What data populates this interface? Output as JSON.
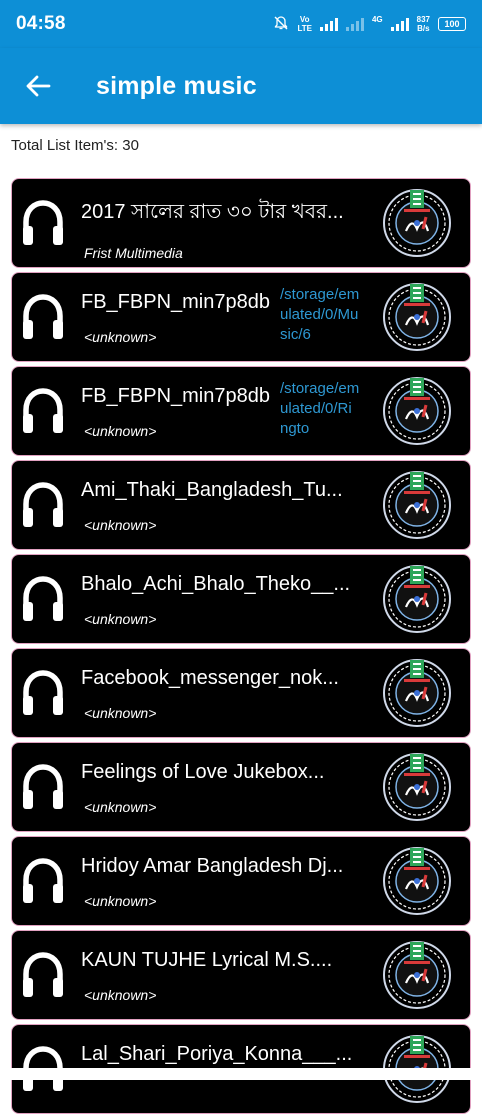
{
  "status": {
    "time": "04:58",
    "net_top": "Vo",
    "net_bottom": "LTE",
    "net4g": "4G",
    "speed_top": "837",
    "speed_bottom": "B/s",
    "battery": "100"
  },
  "appbar": {
    "title": "simple music"
  },
  "list": {
    "count_label": "Total List Item's: 30",
    "items": [
      {
        "name": "2017 সালের রাত ৩০ টার খবর...",
        "artist": "Frist Multimedia",
        "path": ""
      },
      {
        "name": "FB_FBPN_min7p8db",
        "artist": "<unknown>",
        "path": "/storage/emulated/0/Music/6"
      },
      {
        "name": "FB_FBPN_min7p8db",
        "artist": "<unknown>",
        "path": "/storage/emulated/0/Ringto"
      },
      {
        "name": "Ami_Thaki_Bangladesh_Tu...",
        "artist": "<unknown>",
        "path": ""
      },
      {
        "name": "Bhalo_Achi_Bhalo_Theko__...",
        "artist": "<unknown>",
        "path": ""
      },
      {
        "name": "Facebook_messenger_nok...",
        "artist": "<unknown>",
        "path": ""
      },
      {
        "name": "Feelings of Love Jukebox...",
        "artist": "<unknown>",
        "path": ""
      },
      {
        "name": "Hridoy Amar Bangladesh Dj...",
        "artist": "<unknown>",
        "path": ""
      },
      {
        "name": "KAUN TUJHE  Lyrical  M.S....",
        "artist": "<unknown>",
        "path": ""
      },
      {
        "name": "Lal_Shari_Poriya_Konna___...",
        "artist": "",
        "path": ""
      }
    ]
  },
  "colors": {
    "accent": "#0d8fd6",
    "row_bg": "#000000",
    "row_border": "#e0a0c0",
    "path_text": "#2e98d2"
  }
}
